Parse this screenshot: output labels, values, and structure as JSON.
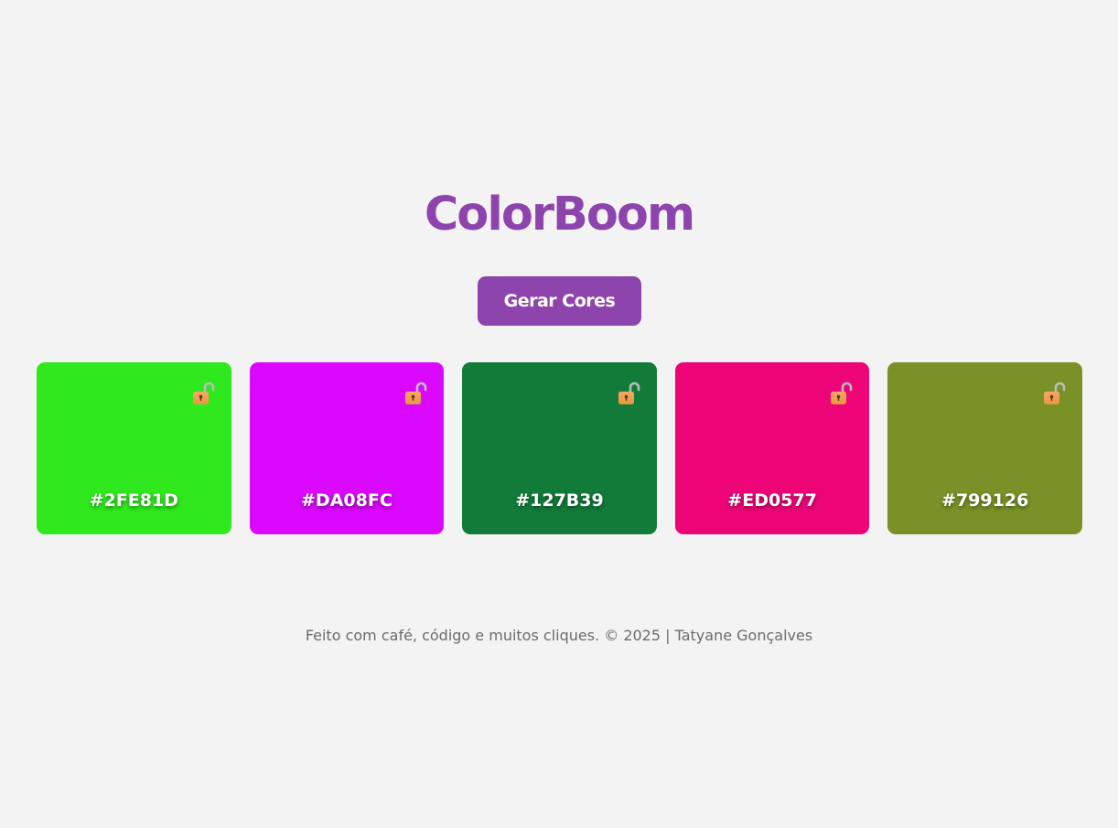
{
  "app": {
    "title": "ColorBoom"
  },
  "controls": {
    "generate_label": "Gerar Cores"
  },
  "palette": [
    {
      "hex": "#2FE81D",
      "color": "#2FE81D",
      "lock_icon": "unlocked-padlock-icon",
      "locked": false
    },
    {
      "hex": "#DA08FC",
      "color": "#DA08FC",
      "lock_icon": "unlocked-padlock-icon",
      "locked": false
    },
    {
      "hex": "#127B39",
      "color": "#127B39",
      "lock_icon": "unlocked-padlock-icon",
      "locked": false
    },
    {
      "hex": "#ED0577",
      "color": "#ED0577",
      "lock_icon": "unlocked-padlock-icon",
      "locked": false
    },
    {
      "hex": "#799126",
      "color": "#799126",
      "lock_icon": "unlocked-padlock-icon",
      "locked": false
    }
  ],
  "theme": {
    "accent": "#8e44ad",
    "background": "#f4f3f4",
    "footer_text": "#6b6b6b"
  },
  "footer": {
    "text": "Feito com café, código e muitos cliques. © 2025 | Tatyane Gonçalves"
  }
}
